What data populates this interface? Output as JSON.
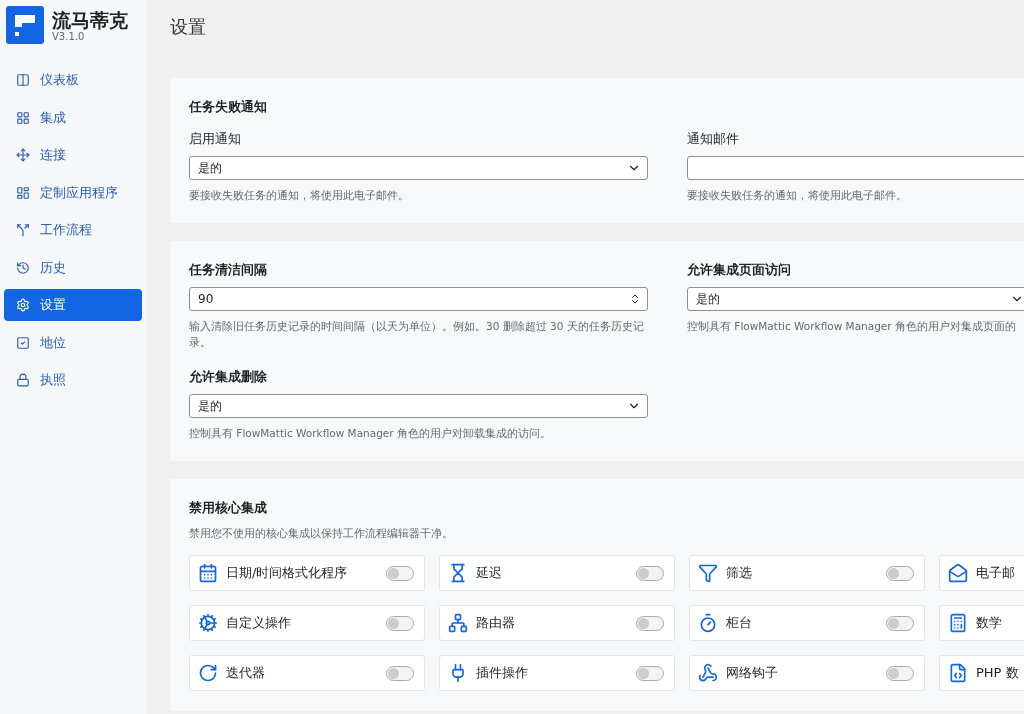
{
  "brand": {
    "name": "流马蒂克",
    "version": "V3.1.0"
  },
  "sidebar": {
    "items": [
      {
        "label": "仪表板",
        "selected": false
      },
      {
        "label": "集成",
        "selected": false
      },
      {
        "label": "连接",
        "selected": false
      },
      {
        "label": "定制应用程序",
        "selected": false
      },
      {
        "label": "工作流程",
        "selected": false
      },
      {
        "label": "历史",
        "selected": false
      },
      {
        "label": "设置",
        "selected": true
      },
      {
        "label": "地位",
        "selected": false
      },
      {
        "label": "执照",
        "selected": false
      }
    ]
  },
  "page_title": "设置",
  "notification_card": {
    "title": "任务失败通知",
    "fields": [
      {
        "kind": "select",
        "label": "启用通知",
        "value": "是的",
        "help": "要接收失败任务的通知，将使用此电子邮件。"
      },
      {
        "kind": "text",
        "label": "通知邮件",
        "help": "要接收失败任务的通知，将使用此电子邮件。"
      }
    ]
  },
  "cleanup_card": {
    "fields": [
      {
        "kind": "number",
        "label": "任务清洁间隔",
        "value": "90",
        "help": "输入清除旧任务历史记录的时间间隔（以天为单位）。例如。30 删除超过 30 天的任务历史记录。"
      },
      {
        "kind": "select",
        "label": "允许集成页面访问",
        "value": "是的",
        "help": "控制具有 FlowMattic Workflow Manager 角色的用户对集成页面的"
      },
      {
        "kind": "select",
        "label": "允许集成删除",
        "value": "是的",
        "help": "控制具有 FlowMattic Workflow Manager 角色的用户对卸载集成的访问。"
      }
    ]
  },
  "core_card": {
    "title": "禁用核心集成",
    "description": "禁用您不使用的核心集成以保持工作流程编辑器干净。",
    "items": [
      {
        "label": "日期/时间格式化程序",
        "on": false
      },
      {
        "label": "延迟",
        "on": false
      },
      {
        "label": "筛选",
        "on": false
      },
      {
        "label": "电子邮"
      },
      {
        "label": "自定义操作",
        "on": false
      },
      {
        "label": "路由器",
        "on": false
      },
      {
        "label": "柜台",
        "on": false
      },
      {
        "label": "数学"
      },
      {
        "label": "迭代器",
        "on": false
      },
      {
        "label": "插件操作",
        "on": false
      },
      {
        "label": "网络钩子",
        "on": false
      },
      {
        "label": "PHP 数"
      }
    ]
  }
}
